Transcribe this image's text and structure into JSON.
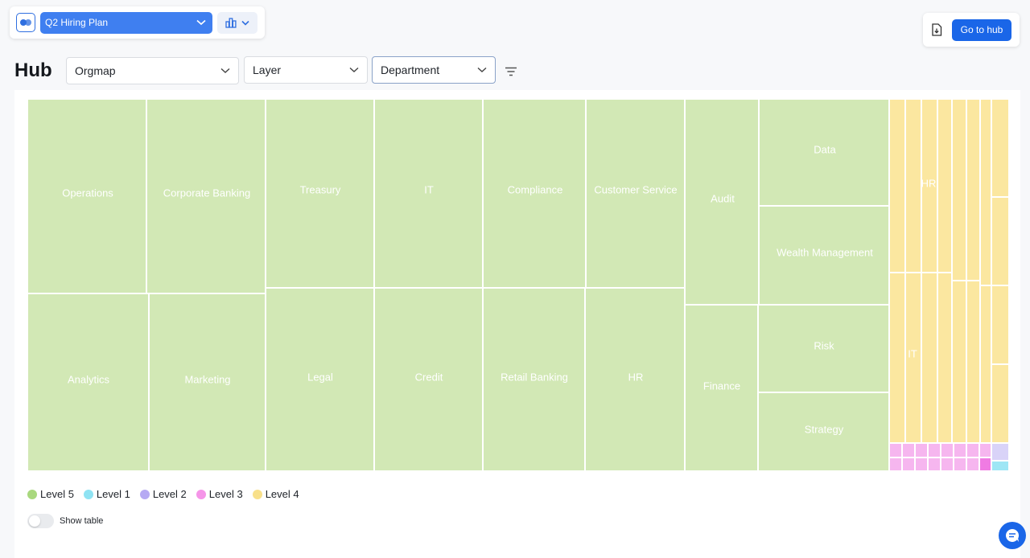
{
  "header": {
    "plan_name": "Q2 Hiring Plan",
    "go_to_hub_label": "Go to hub",
    "icons": [
      "app-logo-icon",
      "chevron-down-icon",
      "bar-chart-icon",
      "file-download-icon",
      "filter-icon",
      "chat-icon"
    ]
  },
  "page": {
    "title": "Hub",
    "view_select": "Orgmap",
    "group_select": "Layer",
    "color_select": "Department"
  },
  "colors": {
    "level5": "#d2e8b5",
    "level1": "#9ee6f5",
    "level2": "#c7c0f5",
    "level3": "#f6b6ef",
    "level4": "#fbe7a0",
    "level3_dark": "#f07be3",
    "level2_light": "#d9d3f8",
    "accent": "#1a66e8"
  },
  "treemap": {
    "labels": {
      "operations": "Operations",
      "corporate_banking": "Corporate Banking",
      "treasury": "Treasury",
      "it": "IT",
      "compliance": "Compliance",
      "customer_service": "Customer Service",
      "audit": "Audit",
      "data": "Data",
      "wealth_management": "Wealth Management",
      "risk": "Risk",
      "strategy": "Strategy",
      "analytics": "Analytics",
      "marketing": "Marketing",
      "legal": "Legal",
      "credit": "Credit",
      "retail_banking": "Retail Banking",
      "hr": "HR",
      "finance": "Finance",
      "hr_small": "HR",
      "it_small": "IT"
    }
  },
  "legend": [
    {
      "label": "Level 5",
      "color": "#a9d87e"
    },
    {
      "label": "Level 1",
      "color": "#8fe3f3"
    },
    {
      "label": "Level 2",
      "color": "#b6aaf3"
    },
    {
      "label": "Level 3",
      "color": "#f595e8"
    },
    {
      "label": "Level 4",
      "color": "#f8e08a"
    }
  ],
  "show_table": {
    "label": "Show table",
    "enabled": false
  }
}
